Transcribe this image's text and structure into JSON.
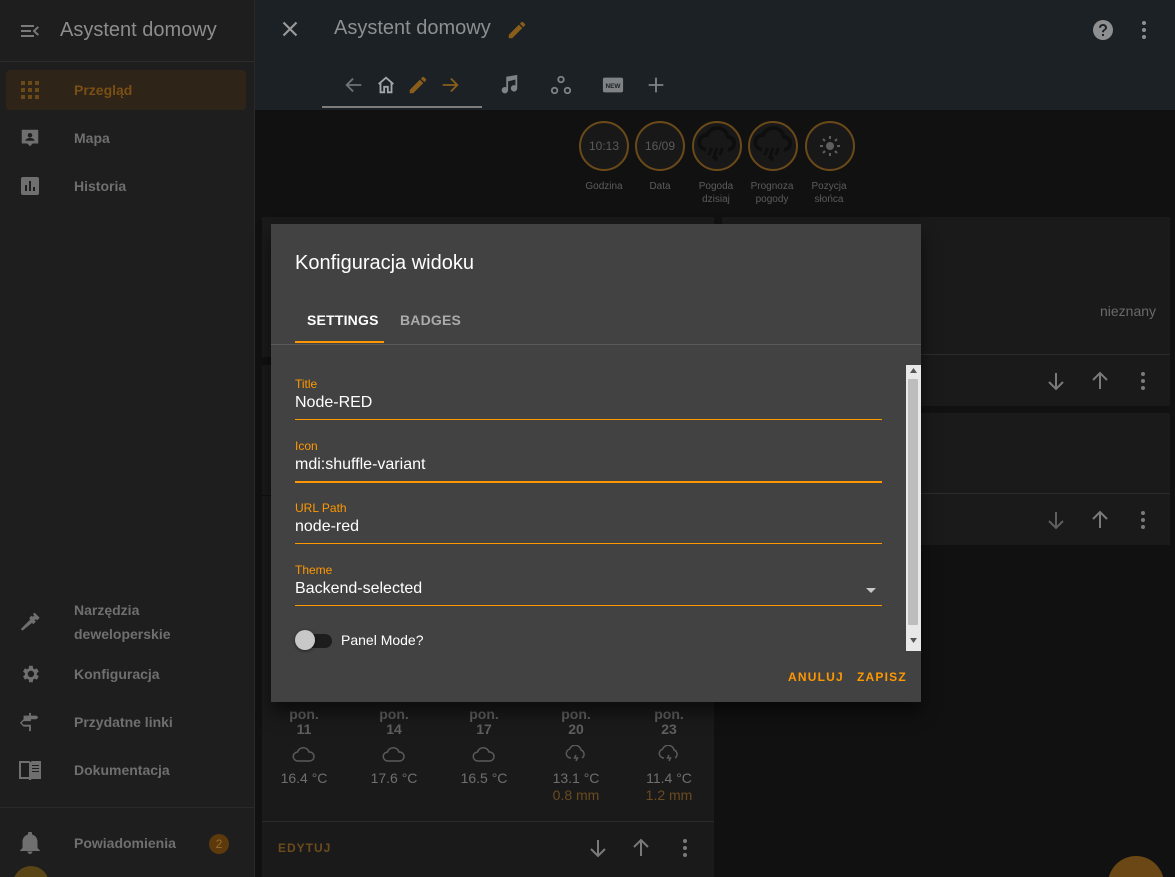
{
  "sidebar": {
    "title": "Asystent domowy",
    "items": [
      {
        "label": "Przegląd"
      },
      {
        "label": "Mapa"
      },
      {
        "label": "Historia"
      }
    ],
    "bottom_items": [
      {
        "label": "Narzędzia\ndeweloperskie"
      },
      {
        "label": "Konfiguracja"
      },
      {
        "label": "Przydatne linki"
      },
      {
        "label": "Dokumentacja"
      }
    ],
    "notifications": {
      "label": "Powiadomienia",
      "count": "2"
    }
  },
  "toolbar": {
    "title": "Asystent domowy"
  },
  "badges": [
    {
      "value": "10:13",
      "label": "Godzina"
    },
    {
      "value": "16/09",
      "label": "Data"
    },
    {
      "value": "",
      "label": "Pogoda\ndzisiaj"
    },
    {
      "value": "",
      "label": "Prognoza\npogody"
    },
    {
      "value": "",
      "label": "Pozycja\nsłońca"
    }
  ],
  "cards": {
    "unknown_text": "nieznany",
    "edit_label": "EDYTUJ"
  },
  "forecast": [
    {
      "day": "pon.",
      "date": "11",
      "temp": "16.4 °C",
      "rain": ""
    },
    {
      "day": "pon.",
      "date": "14",
      "temp": "17.6 °C",
      "rain": ""
    },
    {
      "day": "pon.",
      "date": "17",
      "temp": "16.5 °C",
      "rain": ""
    },
    {
      "day": "pon.",
      "date": "20",
      "temp": "13.1 °C",
      "rain": "0.8 mm"
    },
    {
      "day": "pon.",
      "date": "23",
      "temp": "11.4 °C",
      "rain": "1.2 mm"
    }
  ],
  "dialog": {
    "title": "Konfiguracja widoku",
    "tabs": [
      "SETTINGS",
      "BADGES"
    ],
    "fields": {
      "title": {
        "label": "Title",
        "value": "Node-RED"
      },
      "icon": {
        "label": "Icon",
        "value": "mdi:shuffle-variant"
      },
      "url_path": {
        "label": "URL Path",
        "value": "node-red"
      },
      "theme": {
        "label": "Theme",
        "value": "Backend-selected"
      }
    },
    "panel_mode_label": "Panel Mode?",
    "cancel_label": "ANULUJ",
    "save_label": "ZAPISZ"
  },
  "colors": {
    "accent": "#ff9800",
    "dialog_bg": "#424242",
    "sidebar_bg": "#1e1e1e"
  }
}
